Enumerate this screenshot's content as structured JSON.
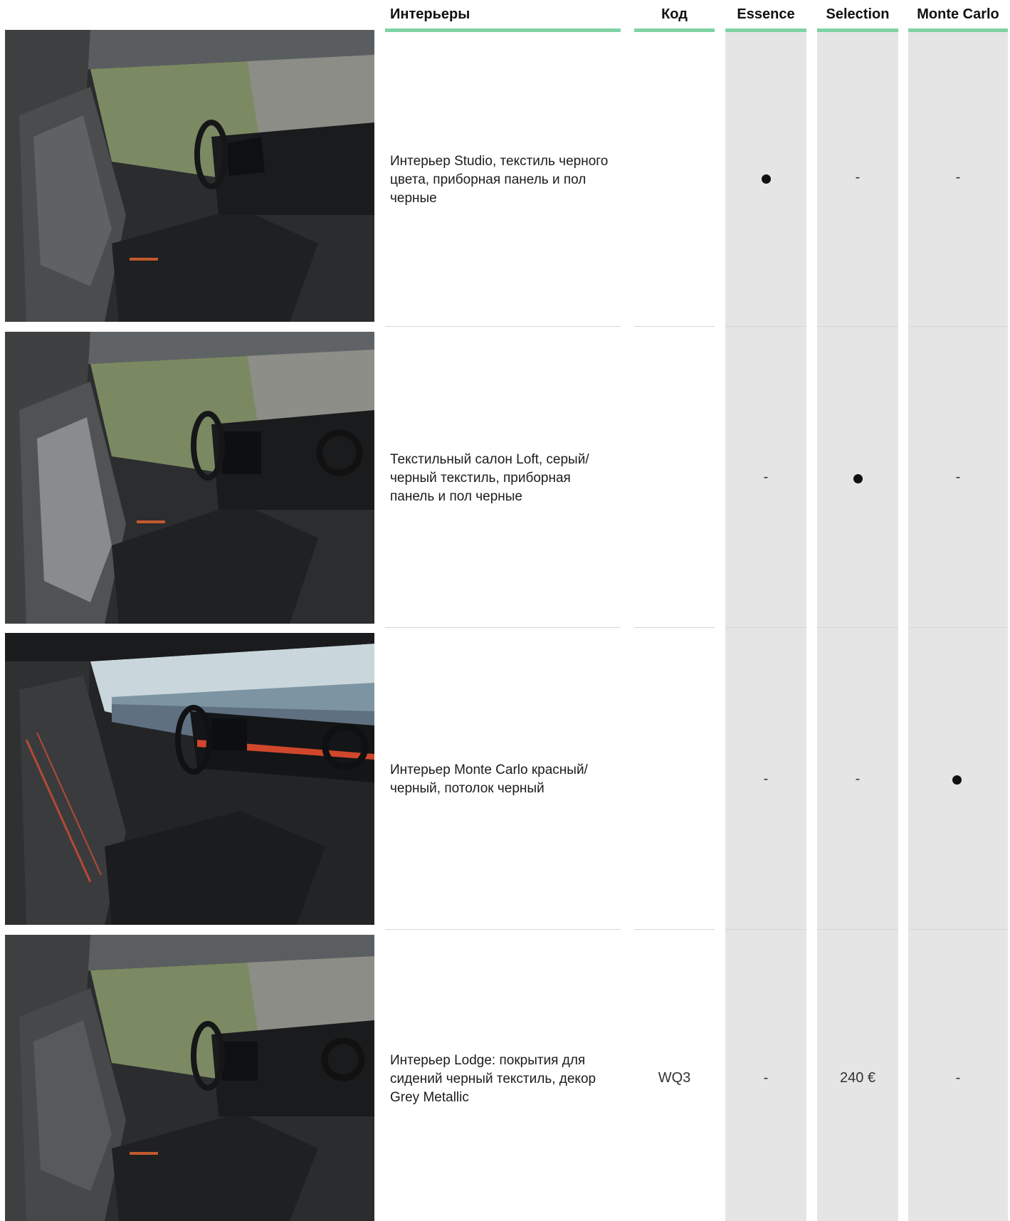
{
  "headers": {
    "interiors": "Интерьеры",
    "code": "Код",
    "essence": "Essence",
    "selection": "Selection",
    "monte_carlo": "Monte Carlo"
  },
  "colors": {
    "accent_line": "#7ed3a3",
    "trim_column_bg": "#e5e5e5"
  },
  "rows": [
    {
      "photo": "car-interior-studio-photo",
      "description": "Интерьер Studio, текстиль черного цвета, приборная панель и пол черные",
      "code": "",
      "essence": "●",
      "selection": "-",
      "monte_carlo": "-"
    },
    {
      "photo": "car-interior-loft-photo",
      "description": "Текстильный салон Loft, серый/черный текстиль, приборная панель и пол черные",
      "code": "",
      "essence": "-",
      "selection": "●",
      "monte_carlo": "-"
    },
    {
      "photo": "car-interior-monte-carlo-photo",
      "description": "Интерьер Monte Carlo красный/черный, потолок черный",
      "code": "",
      "essence": "-",
      "selection": "-",
      "monte_carlo": "●"
    },
    {
      "photo": "car-interior-lodge-photo",
      "description": "Интерьер Lodge: покрытия для сидений черный текстиль, декор Grey Metallic",
      "code": "WQ3",
      "essence": "-",
      "selection": "240 €",
      "monte_carlo": "-"
    }
  ]
}
